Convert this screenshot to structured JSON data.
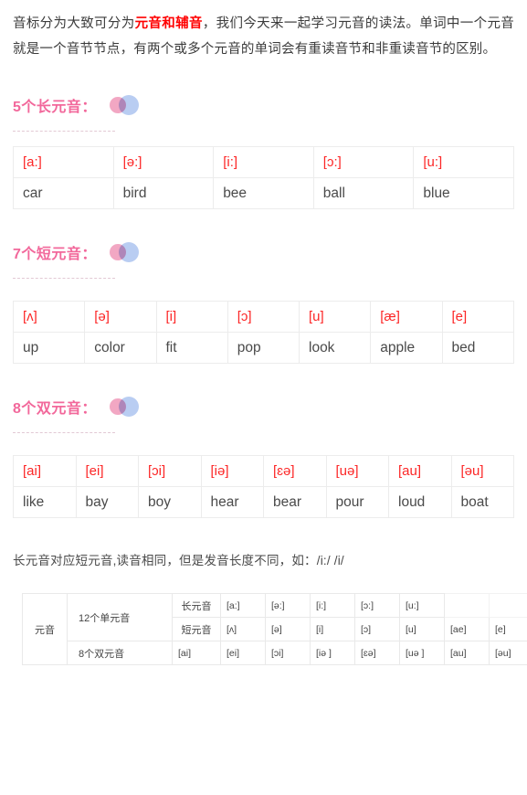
{
  "intro": {
    "before": "音标分为大致可分为",
    "emphasis": "元音和辅音",
    "after": "，我们今天来一起学习元音的读法。单词中一个元音就是一个音节节点，有两个或多个元音的单词会有重读音节和非重读音节的区别。"
  },
  "sections": [
    {
      "title": "5个长元音：",
      "icon": "two-circles-icon",
      "symbols": [
        "[a:]",
        "[ə:]",
        "[i:]",
        "[ɔ:]",
        "[u:]"
      ],
      "words": [
        "car",
        "bird",
        "bee",
        "ball",
        "blue"
      ]
    },
    {
      "title": "7个短元音：",
      "icon": "two-circles-icon",
      "symbols": [
        "[ʌ]",
        "[ə]",
        "[i]",
        "[ɔ]",
        "[u]",
        "[æ]",
        "[e]"
      ],
      "words": [
        "up",
        "color",
        "fit",
        "pop",
        "look",
        "apple",
        "bed"
      ]
    },
    {
      "title": "8个双元音：",
      "icon": "two-circles-icon",
      "symbols": [
        "[ai]",
        "[ei]",
        "[ɔi]",
        "[iə]",
        "[ɛə]",
        "[uə]",
        "[au]",
        "[əu]"
      ],
      "words": [
        "like",
        "bay",
        "boy",
        "hear",
        "bear",
        "pour",
        "loud",
        "boat"
      ]
    }
  ],
  "note": "长元音对应短元音,读音相同，但是发音长度不同，如：/i:/  /i/",
  "summary": {
    "vowel_label": "元音",
    "monophthong_label": "12个单元音",
    "diphthong_label": "8个双元音",
    "long_label": "长元音",
    "short_label": "短元音",
    "long_symbols": [
      "[a:]",
      "[ə:]",
      "[i:]",
      "[ɔ:]",
      "[u:]"
    ],
    "short_symbols": [
      "[ʌ]",
      "[ə]",
      "[i]",
      "[ɔ]",
      "[u]",
      "[ae]",
      "[e]"
    ],
    "diphthong_symbols": [
      "[ai]",
      "[ei]",
      "[ɔi]",
      "[iə ]",
      "[ɛə]",
      "[uə ]",
      "[au]",
      "[əu]"
    ]
  },
  "colors": {
    "heading_pink": "#f2689b",
    "emphasis_red": "#ff0000",
    "symbol_red": "#fc2626",
    "border_gray": "#ececec",
    "circle_pink": "#f2a7c3",
    "circle_blue": "#b9cdf2"
  }
}
